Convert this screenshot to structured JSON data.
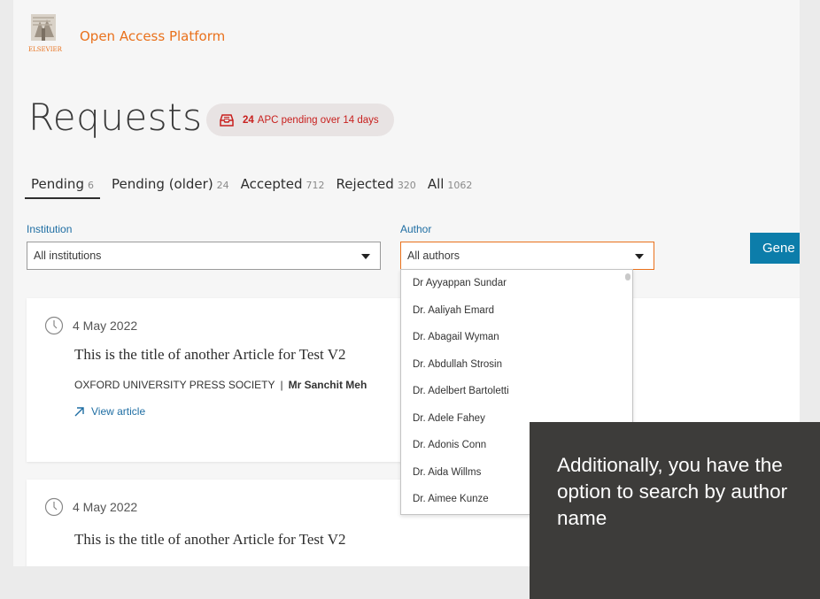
{
  "header": {
    "brand": "Open Access Platform",
    "logo_text": "ELSEVIER"
  },
  "page": {
    "title": "Requests",
    "badge": {
      "count": "24",
      "text": "APC pending over 14 days",
      "icon": "inbox-alert-icon"
    }
  },
  "tabs": [
    {
      "label": "Pending",
      "count": "6",
      "active": true
    },
    {
      "label": "Pending (older)",
      "count": "24"
    },
    {
      "label": "Accepted",
      "count": "712"
    },
    {
      "label": "Rejected",
      "count": "320"
    },
    {
      "label": "All",
      "count": "1062"
    }
  ],
  "filters": {
    "institution": {
      "label": "Institution",
      "value": "All institutions"
    },
    "author": {
      "label": "Author",
      "value": "All authors"
    },
    "generate_label": "Gene"
  },
  "author_options": [
    "Dr Ayyappan Sundar",
    "Dr. Aaliyah Emard",
    "Dr. Abagail Wyman",
    "Dr. Abdullah Strosin",
    "Dr. Adelbert Bartoletti",
    "Dr. Adele Fahey",
    "Dr. Adonis Conn",
    "Dr. Aida Willms",
    "Dr. Aimee Kunze"
  ],
  "cards": [
    {
      "date": "4 May 2022",
      "title": "This is the title of another Article for Test V2",
      "publisher": "OXFORD UNIVERSITY PRESS SOCIETY",
      "author": "Mr Sanchit Meh",
      "view_label": "View article"
    },
    {
      "date": "4 May 2022",
      "title": "This is the title of another Article for Test V2"
    }
  ],
  "tooltip": {
    "text": "Additionally, you have the option to search by author name"
  },
  "colors": {
    "brand_orange": "#e9711c",
    "link_blue": "#1f6ea3",
    "button_blue": "#0c7daa",
    "alert_red": "#c8201e",
    "tooltip_bg": "#3d3c3a"
  }
}
